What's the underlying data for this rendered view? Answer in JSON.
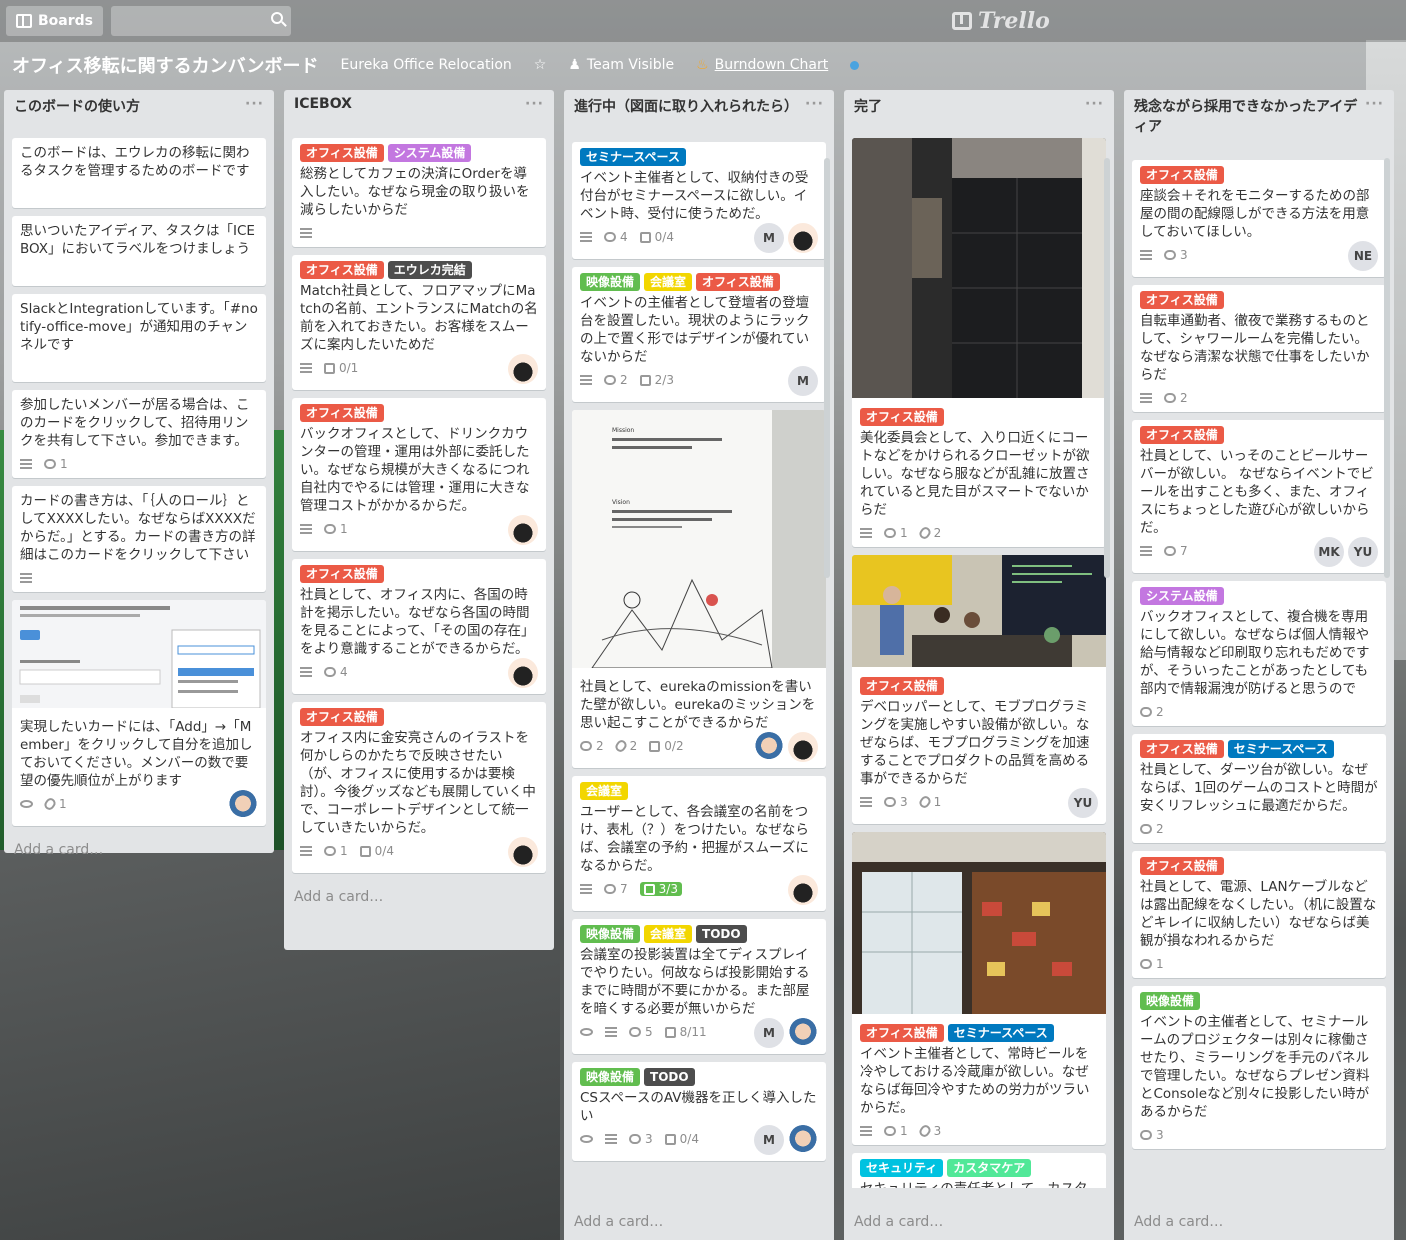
{
  "header": {
    "boards_label": "Boards",
    "search_value": "",
    "logo": "Trello"
  },
  "board": {
    "title": "オフィス移転に関するカンバンボード",
    "org": "Eureka Office Relocation",
    "visibility": "Team Visible",
    "powerup": "Burndown Chart"
  },
  "add_card": "Add a card…",
  "colors": {
    "green": "#61bd4f",
    "yellow": "#f2d600",
    "orange": "#ffab4a",
    "red": "#eb5a46",
    "purple": "#c377e0",
    "blue": "#0079bf",
    "sky": "#00c2e0",
    "lime": "#51e898",
    "black": "#4d4d4d"
  },
  "lists": [
    {
      "title": "このボードの使い方",
      "cards": [
        {
          "text": "このボードは、エウレカの移転に関わるタスクを管理するためのボードです"
        },
        {
          "text": "思いついたアイディア、タスクは「ICE BOX」においてラベルをつけましょう"
        },
        {
          "text": "SlackとIntegrationしています。「#notify-office-move」が通知用のチャンネルです"
        },
        {
          "text": "参加したいメンバーが居る場合は、このカードをクリックして、招待用リンクを共有して下さい。参加できます。",
          "comments": "1"
        },
        {
          "text": "カードの書き方は、「｛人のロール｝としてXXXXしたい。なぜならばXXXXだからだ。」とする。カードの書き方の詳細はこのカードをクリックして下さい"
        },
        {
          "text": "実現したいカードには、「Add」→「Member」をクリックして自分を追加しておいてください。メンバーの数で要望の優先順位が上がります",
          "attachments": "1"
        }
      ]
    },
    {
      "title": "ICEBOX",
      "cards": [
        {
          "labels": [
            "オフィス設備",
            "システム設備"
          ],
          "text": "総務としてカフェの決済にOrderを導入したい。なぜなら現金の取り扱いを減らしたいからだ"
        },
        {
          "labels": [
            "オフィス設備",
            "エウレカ完結"
          ],
          "text": "Match社員として、フロアマップにMatchの名前、エントランスにMatchの名前を入れておきたい。お客様をスムーズに案内したいためだ",
          "check": "0/1"
        },
        {
          "labels": [
            "オフィス設備"
          ],
          "text": "バックオフィスとして、ドリンクカウンターの管理・運用は外部に委託したい。なぜなら規模が大きくなるにつれ自社内でやるには管理・運用に大きな管理コストがかかるからだ。",
          "comments": "1"
        },
        {
          "labels": [
            "オフィス設備"
          ],
          "text": "社員として、オフィス内に、各国の時計を掲示したい。なぜなら各国の時間を見ることによって、「その国の存在」をより意識することができるからだ。",
          "comments": "4"
        },
        {
          "labels": [
            "オフィス設備"
          ],
          "text": "オフィス内に金安亮さんのイラストを何かしらのかたちで反映させたい（が、オフィスに使用するかは要検討）。今後グッズなども展開していく中で、コーポレートデザインとして統一していきたいからだ。",
          "comments": "1",
          "check": "0/4"
        }
      ]
    },
    {
      "title": "進行中（図面に取り入れられたら）",
      "cards": [
        {
          "labels": [
            "セミナースペース"
          ],
          "text": "イベント主催者として、収納付きの受付台がセミナースペースに欲しい。イベント時、受付に使うためだ。",
          "comments": "4",
          "check": "0/4",
          "members": [
            "M"
          ]
        },
        {
          "labels": [
            "映像設備",
            "会議室",
            "オフィス設備"
          ],
          "text": "イベントの主催者として登壇者の登壇台を設置したい。現状のようにラックの上で置く形ではデザインが優れていないからだ",
          "comments": "2",
          "check": "2/3",
          "members": [
            "M"
          ]
        },
        {
          "text": "社員として、eurekaのmissionを書いた壁が欲しい。eurekaのミッションを思い起こすことができるからだ",
          "comments": "2",
          "attachments": "2",
          "check": "0/2",
          "cover": {
            "mission": "Mission",
            "vision": "Vision"
          }
        },
        {
          "labels": [
            "会議室"
          ],
          "text": "ユーザーとして、各会議室の名前をつけ、表札（？）をつけたい。なぜならば、会議室の予約・把握がスムーズになるからだ。",
          "comments": "7",
          "check": "3/3"
        },
        {
          "labels": [
            "映像設備",
            "会議室",
            "TODO"
          ],
          "text": "会議室の投影装置は全てディスプレイでやりたい。何故ならば投影開始するまでに時間が不要にかかる。また部屋を暗くする必要が無いからだ",
          "comments": "5",
          "check": "8/11",
          "members": [
            "M"
          ]
        },
        {
          "labels": [
            "映像設備",
            "TODO"
          ],
          "text": "CSスペースのAV機器を正しく導入したい",
          "comments": "3",
          "check": "0/4",
          "members": [
            "M"
          ]
        }
      ]
    },
    {
      "title": "完了",
      "cards": [
        {
          "labels": [
            "オフィス設備"
          ],
          "text": "美化委員会として、入り口近くにコートなどをかけられるクローゼットが欲しい。なぜなら服などが乱雑に放置されていると見た目がスマートでないからだ",
          "comments": "1",
          "attachments": "2"
        },
        {
          "labels": [
            "オフィス設備"
          ],
          "text": "デベロッパーとして、モブプログラミングを実施しやすい設備が欲しい。なぜならば、モブプログラミングを加速することでプロダクトの品質を高める事ができるからだ",
          "comments": "3",
          "attachments": "1",
          "members": [
            "YU"
          ]
        },
        {
          "labels": [
            "オフィス設備",
            "セミナースペース"
          ],
          "text": "イベント主催者として、常時ビールを冷やしておける冷蔵庫が欲しい。なぜならば毎回冷やすための労力がツラいからだ。",
          "comments": "1",
          "attachments": "3"
        },
        {
          "labels": [
            "セキュリティ",
            "カスタマケア"
          ],
          "text": "セキュリティの責任者として、カスタマーサポートの部屋が"
        }
      ]
    },
    {
      "title": "残念ながら採用できなかったアイディア",
      "cards": [
        {
          "labels": [
            "オフィス設備"
          ],
          "text": "座談会＋それをモニターするための部屋の間の配線隠しができる方法を用意しておいてほしい。",
          "comments": "3",
          "members": [
            "NE"
          ]
        },
        {
          "labels": [
            "オフィス設備"
          ],
          "text": "自転車通勤者、徹夜で業務するものとして、シャワールームを完備したい。なぜなら清潔な状態で仕事をしたいからだ",
          "comments": "2"
        },
        {
          "labels": [
            "オフィス設備"
          ],
          "text": "社員として、いっそのことビールサーバーが欲しい。 なぜならイベントでビールを出すことも多く、また、オフィスにちょっとした遊び心が欲しいからだ。",
          "comments": "7",
          "members": [
            "MK",
            "YU"
          ]
        },
        {
          "labels": [
            "システム設備"
          ],
          "text": "バックオフィスとして、複合機を専用にして欲しい。なぜならば個人情報や給与情報など印刷取り忘れもだめですが、そういったことがあったとしても部内で情報漏洩が防げると思うので",
          "comments": "2"
        },
        {
          "labels": [
            "オフィス設備",
            "セミナースペース"
          ],
          "text": "社員として、ダーツ台が欲しい。なぜならば、1回のゲームのコストと時間が安くリフレッシュに最適だからだ。",
          "comments": "2"
        },
        {
          "labels": [
            "オフィス設備"
          ],
          "text": "社員として、電源、LANケーブルなどは露出配線をなくしたい。（机に設置などキレイに収納したい）なぜならば美観が損なわれるからだ",
          "comments": "1"
        },
        {
          "labels": [
            "映像設備"
          ],
          "text": "イベントの主催者として、セミナールームのプロジェクターは別々に稼働させたり、ミラーリングを手元のパネルで管理したい。なぜならプレゼン資料とConsoleなど別々に投影したい時があるからだ",
          "comments": "3"
        }
      ]
    }
  ]
}
